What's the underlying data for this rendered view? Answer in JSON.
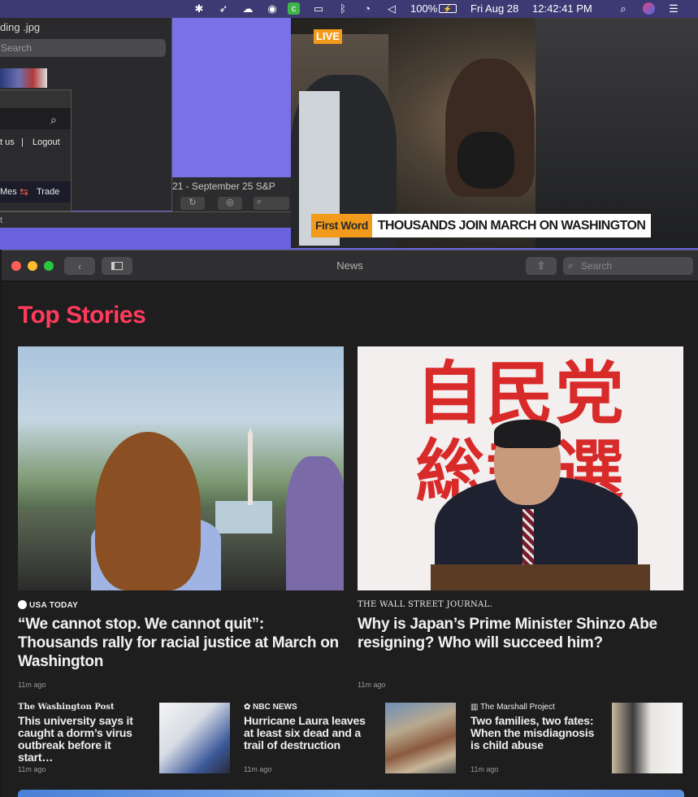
{
  "menubar": {
    "battery_percent": "100%",
    "date": "Fri Aug 28",
    "time": "12:42:41 PM"
  },
  "background": {
    "finder_title": "ding .jpg",
    "finder_search": "Search",
    "browser_links": [
      "t us",
      "Logout"
    ],
    "browser_nav": [
      "Mes",
      "Trade"
    ],
    "chart_footer": "21 - September 25 S&P",
    "strip_text": "t"
  },
  "video": {
    "live_label": "LIVE",
    "tag": "First Word",
    "headline": "THOUSANDS JOIN MARCH ON WASHINGTON"
  },
  "news": {
    "window_title": "News",
    "search_placeholder": "Search",
    "section_title": "Top Stories",
    "top_stories": [
      {
        "source": "USA TODAY",
        "headline": "“We cannot stop. We cannot quit”: Thousands rally for racial justice at March on Washington",
        "time": "11m ago"
      },
      {
        "source": "THE WALL STREET JOURNAL.",
        "headline": "Why is Japan’s Prime Minister Shinzo Abe resigning? Who will succeed him?",
        "time": "11m ago",
        "image_text": "自民党 総裁選 9月"
      }
    ],
    "secondary_stories": [
      {
        "source": "The Washington Post",
        "headline": "This university says it caught a dorm’s virus outbreak before it start…",
        "time": "11m ago"
      },
      {
        "source": "NBC NEWS",
        "headline": "Hurricane Laura leaves at least six dead and a trail of destruction",
        "time": "11m ago"
      },
      {
        "source": "The Marshall Project",
        "headline": "Two families, two fates: When the misdiagnosis is child abuse",
        "time": "11m ago"
      }
    ]
  },
  "colors": {
    "accent_red": "#ff3b5c",
    "menubar": "#3d3a73",
    "bloomberg_orange": "#f19a1b"
  }
}
